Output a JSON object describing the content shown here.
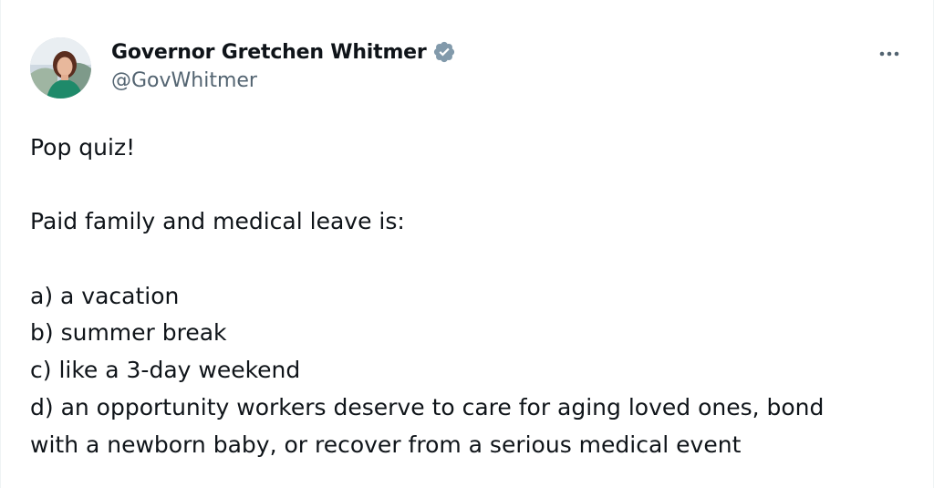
{
  "author": {
    "display_name": "Governor Gretchen Whitmer",
    "handle": "@GovWhitmer",
    "verified_icon": "verified-badge-icon",
    "avatar": "avatar-photo"
  },
  "menu": {
    "more_icon": "more-options-icon"
  },
  "tweet": {
    "line1": "Pop quiz!",
    "line2": "Paid family and medical leave is:",
    "option_a": "a) a vacation",
    "option_b": "b) summer break",
    "option_c": "c) like a 3-day weekend",
    "option_d_1": "d) an opportunity workers deserve to care for aging loved ones, bond",
    "option_d_2": "with a newborn baby, or recover from a serious medical event"
  },
  "colors": {
    "text": "#0f1419",
    "secondary": "#536471",
    "verified": "#829aab"
  }
}
